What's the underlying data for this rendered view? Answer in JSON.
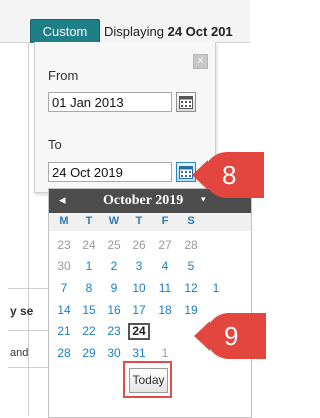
{
  "topbar": {
    "tab_label": "Custom",
    "displaying_prefix": "Displaying",
    "displaying_date": "24 Oct 201"
  },
  "background": {
    "cut_text_1": "y se",
    "cut_text_2": "and"
  },
  "panel": {
    "from_label": "From",
    "from_value": "01 Jan 2013",
    "to_label": "To",
    "to_value": "24 Oct 2019",
    "close_symbol": "×"
  },
  "calendar": {
    "prev_symbol": "◂",
    "month_title": "October 2019",
    "caret_symbol": "▾",
    "weekdays": [
      "M",
      "T",
      "W",
      "T",
      "F",
      "S"
    ],
    "weeks": [
      [
        {
          "d": "23",
          "other": true
        },
        {
          "d": "24",
          "other": true
        },
        {
          "d": "25",
          "other": true
        },
        {
          "d": "26",
          "other": true
        },
        {
          "d": "27",
          "other": true
        },
        {
          "d": "28",
          "other": true
        }
      ],
      [
        {
          "d": "30",
          "other": true
        },
        {
          "d": "1"
        },
        {
          "d": "2"
        },
        {
          "d": "3"
        },
        {
          "d": "4"
        },
        {
          "d": "5"
        }
      ],
      [
        {
          "d": "7"
        },
        {
          "d": "8"
        },
        {
          "d": "9"
        },
        {
          "d": "10"
        },
        {
          "d": "11"
        },
        {
          "d": "12"
        },
        {
          "d": "1"
        }
      ],
      [
        {
          "d": "14"
        },
        {
          "d": "15"
        },
        {
          "d": "16"
        },
        {
          "d": "17"
        },
        {
          "d": "18"
        },
        {
          "d": "19"
        }
      ],
      [
        {
          "d": "21"
        },
        {
          "d": "22"
        },
        {
          "d": "23"
        },
        {
          "d": "24",
          "today": true
        }
      ],
      [
        {
          "d": "28"
        },
        {
          "d": "29"
        },
        {
          "d": "30"
        },
        {
          "d": "31"
        },
        {
          "d": "1",
          "other": true
        }
      ]
    ],
    "today_button": "Today"
  },
  "callouts": {
    "step_8": "8",
    "step_9": "9"
  },
  "colors": {
    "accent": "#1f7f87",
    "callout": "#e2463f",
    "day_link": "#1c7ec3"
  }
}
